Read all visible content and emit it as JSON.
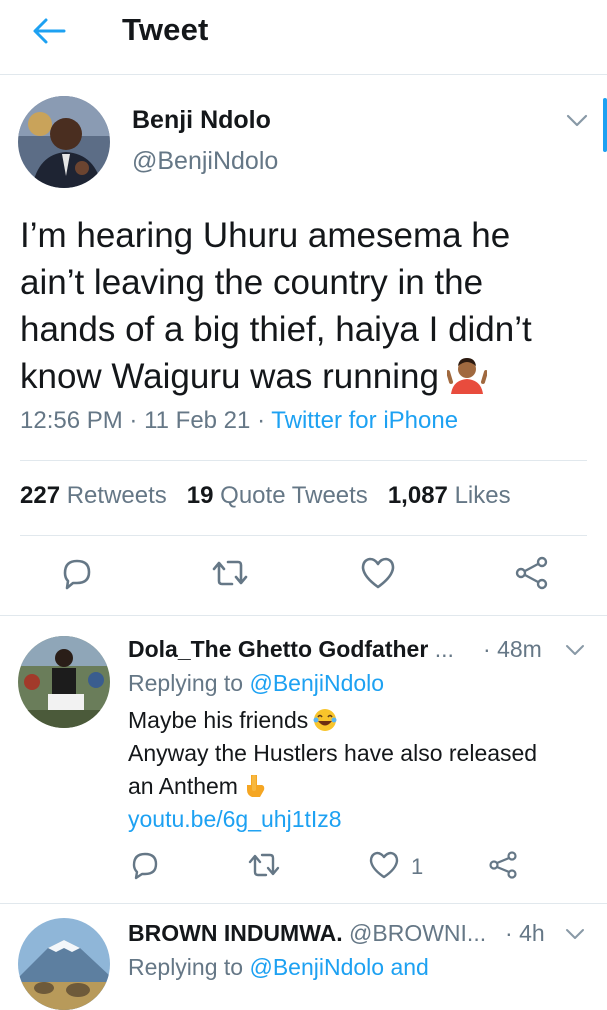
{
  "header": {
    "title": "Tweet",
    "back_icon": "arrow-left-icon"
  },
  "tweet": {
    "author_name": "Benji Ndolo",
    "author_handle": "@BenjiNdolo",
    "text_lines": [
      "I’m hearing Uhuru amesema he",
      "ain’t leaving the country in the",
      "hands of a big thief, haiya I didn’t",
      "know Waiguru was running"
    ],
    "emoji": "person-shrugging-emoji",
    "time": "12:56 PM",
    "date": "11 Feb 21",
    "source": "Twitter for iPhone",
    "stats": {
      "retweets_count": "227",
      "retweets_label": "Retweets",
      "quotes_count": "19",
      "quotes_label": "Quote Tweets",
      "likes_count": "1,087",
      "likes_label": "Likes"
    }
  },
  "replies": [
    {
      "author_name": "Dola_The Ghetto Godfather",
      "ellipsis": "...",
      "time": "48m",
      "replying_prefix": "Replying to",
      "replying_to": "@BenjiNdolo",
      "text_lines": [
        "Maybe his friends",
        "Anyway the Hustlers have also released",
        "an Anthem",
        "youtu.be/6g_uhj1tIz8"
      ],
      "likes": "1"
    },
    {
      "author_name": "BROWN INDUMWA.",
      "author_handle": "@BROWNI...",
      "time": "4h",
      "replying_prefix": "Replying to",
      "replying_to": "@BenjiNdolo and"
    }
  ],
  "colors": {
    "accent": "#1da1f2",
    "muted": "#657786",
    "text": "#14171a",
    "border": "#e1e8ed"
  }
}
